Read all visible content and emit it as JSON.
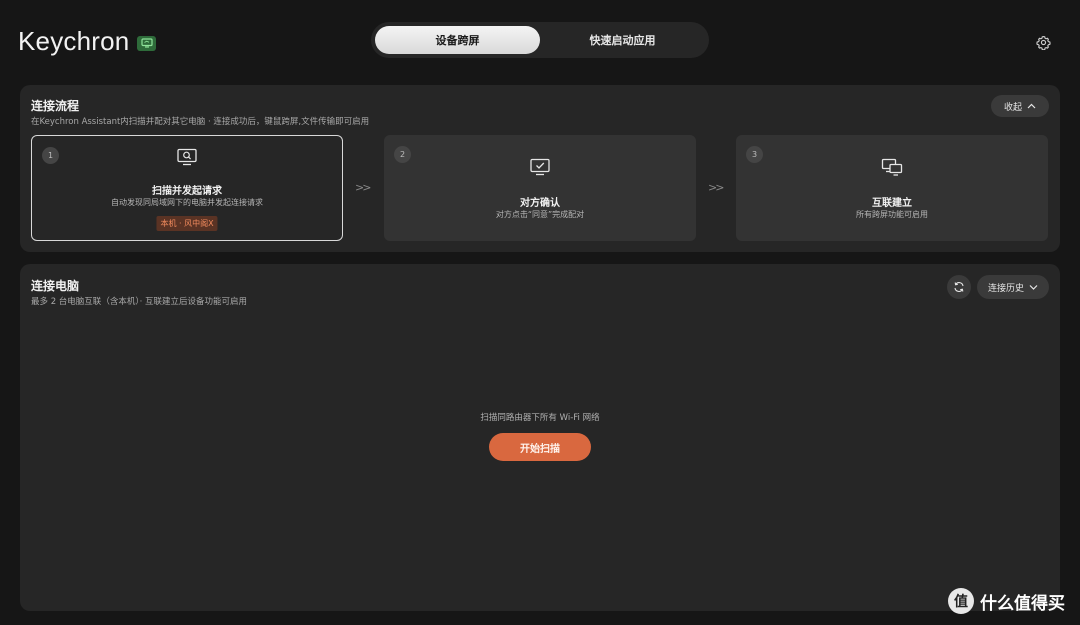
{
  "header": {
    "brand": "Keychron",
    "tabs": [
      {
        "label": "设备跨屏",
        "active": true
      },
      {
        "label": "快速启动应用",
        "active": false
      }
    ],
    "settings_icon": "gear-icon"
  },
  "flow": {
    "title": "连接流程",
    "subtitle": "在Keychron Assistant内扫描并配对其它电脑 · 连接成功后，键鼠跨屏,文件传输即可启用",
    "collapse_label": "收起",
    "steps": [
      {
        "num": "1",
        "icon": "scan-screen-icon",
        "title": "扫描并发起请求",
        "desc": "自动发现同局域网下的电脑并发起连接请求",
        "tag": "本机 · 风中阁X"
      },
      {
        "num": "2",
        "icon": "monitor-check-icon",
        "title": "对方确认",
        "desc": "对方点击“同意”完成配对"
      },
      {
        "num": "3",
        "icon": "dual-monitor-icon",
        "title": "互联建立",
        "desc": "所有跨屏功能可启用"
      }
    ],
    "separator": ">>"
  },
  "connect": {
    "title": "连接电脑",
    "subtitle": "最多 2 台电脑互联（含本机）· 互联建立后设备功能可启用",
    "history_label": "连接历史",
    "empty_message": "扫描同路由器下所有 Wi-Fi 网络",
    "scan_button": "开始扫描"
  },
  "watermark": {
    "logo_char": "值",
    "text": "什么值得买"
  },
  "colors": {
    "accent": "#d9683f",
    "tag_bg": "#5a3324",
    "tag_text": "#f08a5d",
    "badge": "#2e6b3a"
  }
}
